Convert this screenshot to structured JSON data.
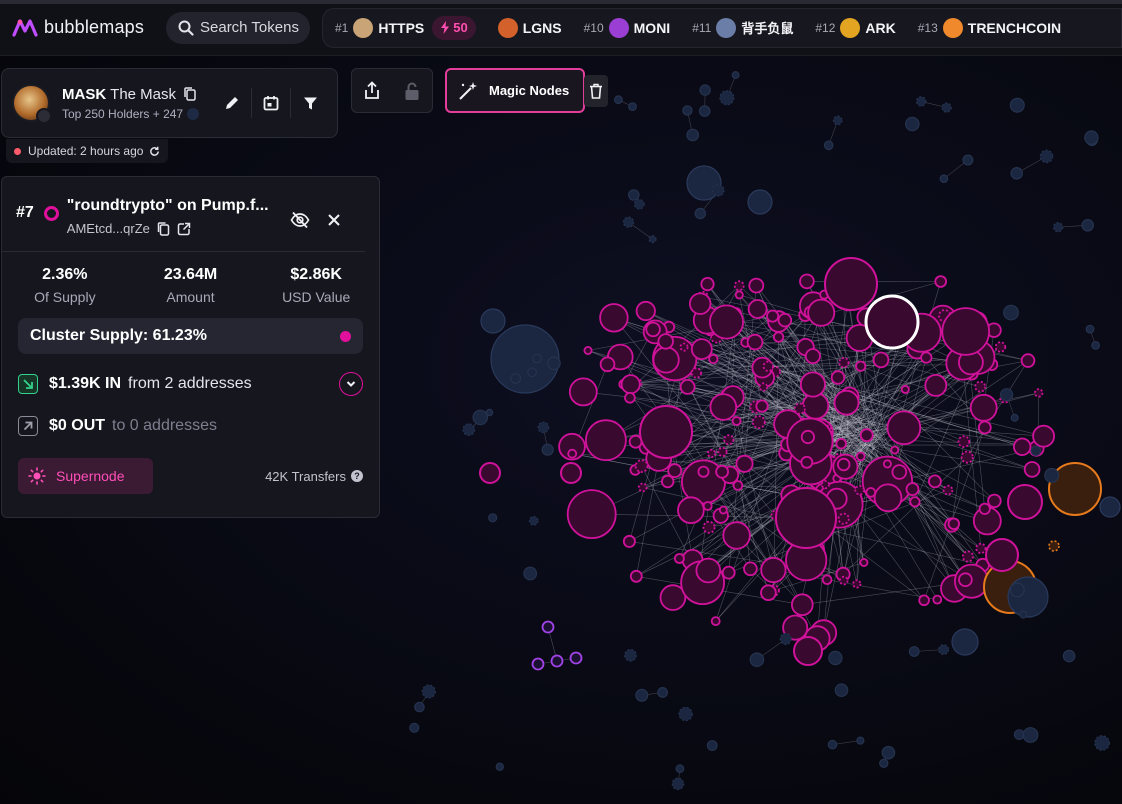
{
  "brand": {
    "name": "bubblemaps",
    "accent": "#e0109c"
  },
  "search": {
    "label": "Search Tokens"
  },
  "ticker": [
    {
      "rank": "#1",
      "name": "HTTPS",
      "boost": "50",
      "avatar": "#c9a477"
    },
    {
      "rank": "",
      "name": "LGNS",
      "avatar": "#d3612b"
    },
    {
      "rank": "#10",
      "name": "MONI",
      "avatar": "#9b3fd4"
    },
    {
      "rank": "#11",
      "name": "背手负鼠",
      "avatar": "#6b7ea8"
    },
    {
      "rank": "#12",
      "name": "ARK",
      "avatar": "#e3a521"
    },
    {
      "rank": "#13",
      "name": "TRENCHCOIN",
      "avatar": "#f0892b"
    }
  ],
  "token": {
    "symbol": "MASK",
    "name": "The Mask",
    "subtitle": "Top 250 Holders + 247",
    "updated": "Updated: 2 hours ago"
  },
  "toolbar": {
    "magic_nodes": "Magic Nodes"
  },
  "holder": {
    "rank": "#7",
    "name": "\"roundtrypto\" on Pump.f...",
    "address": "AMEtcd...qrZe",
    "stats": [
      {
        "value": "2.36%",
        "label": "Of Supply"
      },
      {
        "value": "23.64M",
        "label": "Amount"
      },
      {
        "value": "$2.86K",
        "label": "USD Value"
      }
    ],
    "cluster_supply": "Cluster Supply: 61.23%",
    "inflow": {
      "amount": "$1.39K IN",
      "from": "from 2 addresses"
    },
    "outflow": {
      "amount": "$0 OUT",
      "to": "to 0 addresses"
    },
    "supernode_label": "Supernode",
    "transfers": "42K Transfers"
  },
  "colors": {
    "node_pink": "#d0129b",
    "node_fill": "#3a0930",
    "node_navy": "#1b2640",
    "node_orange": "#e67a1c",
    "node_purple": "#a243e8",
    "edge": "#c9c9d4"
  }
}
